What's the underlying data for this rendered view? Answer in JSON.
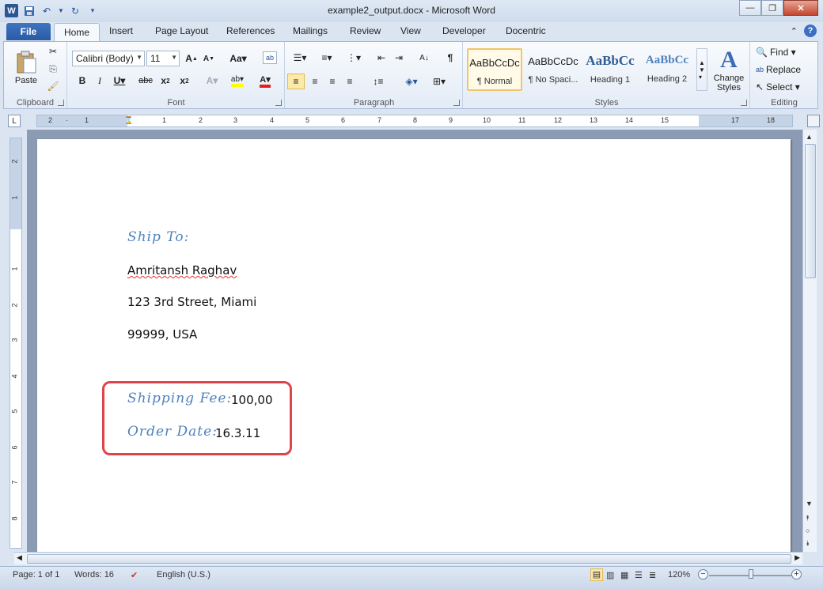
{
  "window": {
    "title": "example2_output.docx - Microsoft Word",
    "icons": [
      "word-logo",
      "save-icon",
      "undo-icon",
      "redo-icon",
      "customize-qat-icon"
    ]
  },
  "tabs": {
    "file": "File",
    "items": [
      "Home",
      "Insert",
      "Page Layout",
      "References",
      "Mailings",
      "Review",
      "View",
      "Developer",
      "Docentric"
    ],
    "active": "Home"
  },
  "ribbon": {
    "clipboard": {
      "label": "Clipboard",
      "paste": "Paste"
    },
    "font": {
      "label": "Font",
      "family": "Calibri (Body)",
      "size": "11"
    },
    "paragraph": {
      "label": "Paragraph"
    },
    "styles": {
      "label": "Styles",
      "items": [
        {
          "sample": "AaBbCcDc",
          "name": "¶ Normal"
        },
        {
          "sample": "AaBbCcDc",
          "name": "¶ No Spaci..."
        },
        {
          "sample": "AaBbCc",
          "name": "Heading 1"
        },
        {
          "sample": "AaBbCc",
          "name": "Heading 2"
        }
      ],
      "change_styles": "Change Styles"
    },
    "editing": {
      "label": "Editing",
      "find": "Find",
      "replace": "Replace",
      "select": "Select"
    }
  },
  "document": {
    "ship_to_label": "Ship To:",
    "name": "Amritansh Raghav",
    "street": "123 3rd Street, Miami",
    "zip_country": "99999, USA",
    "shipping_fee_label": "Shipping Fee:",
    "shipping_fee_value": "100,00",
    "order_date_label": "Order Date:",
    "order_date_value": "16.3.11"
  },
  "status": {
    "page": "Page: 1 of 1",
    "words": "Words: 16",
    "language": "English (U.S.)",
    "zoom": "120%"
  },
  "colors": {
    "heading_italic": "#4f81bd",
    "highlight_box": "#e0434a",
    "file_tab": "#2a5aa6"
  }
}
